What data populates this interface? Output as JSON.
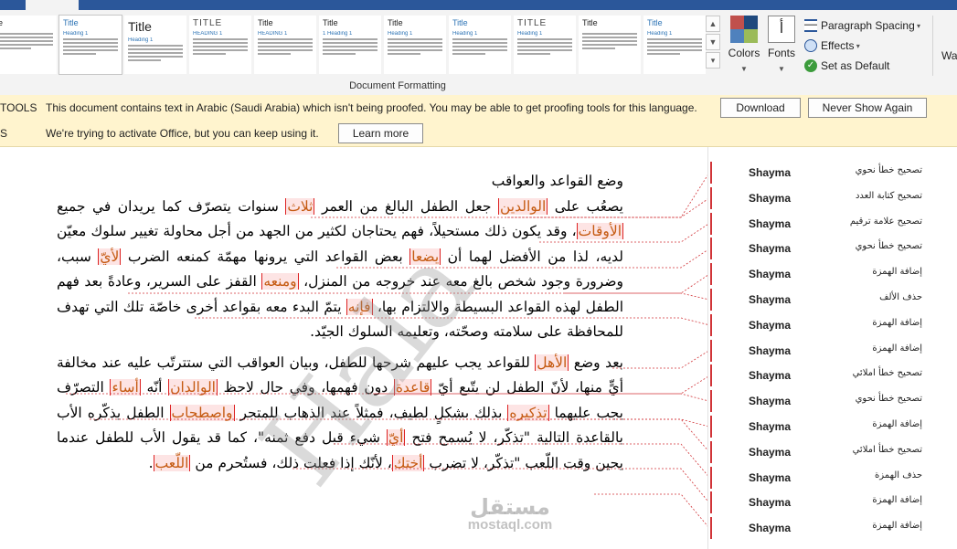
{
  "ribbon": {
    "style_set": [
      {
        "title": "e",
        "heading": "",
        "variant": "dark"
      },
      {
        "title": "Title",
        "heading": "Heading 1",
        "variant": "plain"
      },
      {
        "title": "Title",
        "heading": "Heading 1",
        "variant": "big"
      },
      {
        "title": "TITLE",
        "heading": "HEADING 1",
        "variant": "caps"
      },
      {
        "title": "Title",
        "heading": "HEADING 1",
        "variant": "dark"
      },
      {
        "title": "Title",
        "heading": "1  Heading 1",
        "variant": "dark"
      },
      {
        "title": "Title",
        "heading": "Heading 1",
        "variant": "dark"
      },
      {
        "title": "Title",
        "heading": "Heading 1",
        "variant": "plain"
      },
      {
        "title": "TITLE",
        "heading": "Heading 1",
        "variant": "caps"
      },
      {
        "title": "Title",
        "heading": "",
        "variant": "dark"
      },
      {
        "title": "Title",
        "heading": "Heading 1",
        "variant": "plain"
      }
    ],
    "group_label": "Document Formatting",
    "colors_label": "Colors",
    "fonts_label": "Fonts",
    "fonts_glyph": "أ",
    "paragraph_spacing_label": "Paragraph Spacing",
    "effects_label": "Effects",
    "set_default_label": "Set as Default",
    "cut_off_label": "Wa",
    "colors": {
      "accent": "#2b579a",
      "swatch_a": "#c0504d",
      "swatch_b": "#1f497d",
      "swatch_c": "#4f81bd",
      "swatch_d": "#9bbb59"
    }
  },
  "proofing_bar": {
    "tag": "TOOLS",
    "message": "This document contains text in Arabic (Saudi Arabia) which isn't being proofed. You may be able to get proofing tools for this language.",
    "download_label": "Download",
    "never_show_label": "Never Show Again"
  },
  "activation_bar": {
    "tag": "S",
    "message": "We're trying to activate Office, but you can keep using it.",
    "learn_more_label": "Learn more"
  },
  "document": {
    "title": "وضع القواعد والعواقب",
    "p1": {
      "s1": "يصعُب على ",
      "r1": "الوالدين",
      "s2": " جعل الطفل البالغ من العمر ",
      "r2": "ثلاث",
      "s3": " سنوات يتصرّف كما يريدان في جميع ",
      "r3": "الأوقات",
      "s4": "، وقد يكون ذلك مستحيلاً، فهم يحتاجان لكثير من الجهد من أجل محاولة تغيير سلوك معيّن لديه، لذا من الأفضل لهما أن ",
      "r4": "يضعا",
      "s5": " بعض القواعد التي يرونها مهمّة كمنعه الضرب ",
      "r5": "لأيّ",
      "s6": " سبب، وضرورة وجود شخص بالغ معه عند خروجه من المنزل، ",
      "r6": "ومنعه",
      "s7": " القفز على السرير، وعادةً بعد فهم الطفل لهذه القواعد البسيطة والالتزام بها، ",
      "r7": "فإنه",
      "s8": " يتمّ البدء معه بقواعد أخرى خاصّة تلك التي تهدف للمحافظة على سلامته وصحّته، وتعليمه السلوك الجيّد."
    },
    "p2": {
      "s1": "بعد وضع ",
      "r1": "الأهل",
      "s2": " للقواعد يجب عليهم شرحها للطفل، وبيان العواقب التي ستترتّب عليه عند مخالفة أيٍّ منها، لأنّ الطفل لن يتّبع أيّ ",
      "r2": "قاعدة",
      "s3": " دون فهمها، وفي حال لاحظ ",
      "r3": "الوالدان",
      "s4": " أنّه ",
      "r4": "أساء",
      "s5": " التصرّف يجب عليهما ",
      "r5": "تذكيره",
      "s6": " بذلك بشكلٍ لطيف، فمثلاً عند الذهاب للمتجر ",
      "r6": "واصطحاب",
      "s7": " الطفل يذكّره الأب بالقاعدة التالية \"تذكّر، لا يُسمح فتح ",
      "r7": "أيّ",
      "s8": " شيء قبل دفع ثمنه\"، كما قد يقول الأب للطفل عندما يحين وقت اللّعب \"تذكّر، لا تضرب ",
      "r8": "أختك",
      "s9": "، لأنّك إذا فعلت ذلك، فستُحرم من ",
      "r9": "اللّعب",
      "s10": "."
    }
  },
  "comments": [
    {
      "author": "Shayma",
      "note": "تصحيح خطأ نحوي"
    },
    {
      "author": "Shayma",
      "note": "تصحيح كتابة العدد"
    },
    {
      "author": "Shayma",
      "note": "تصحيح علامة ترقيم"
    },
    {
      "author": "Shayma",
      "note": "تصحيح خطأ نحوي"
    },
    {
      "author": "Shayma",
      "note": "إضافة الهمزة"
    },
    {
      "author": "Shayma",
      "note": "حذف الألف"
    },
    {
      "author": "Shayma",
      "note": "إضافة الهمزة"
    },
    {
      "author": "Shayma",
      "note": "إضافة الهمزة"
    },
    {
      "author": "Shayma",
      "note": "تصحيح خطأ املائي"
    },
    {
      "author": "Shayma",
      "note": "تصحيح خطأ نحوي"
    },
    {
      "author": "Shayma",
      "note": "إضافة الهمزة"
    },
    {
      "author": "Shayma",
      "note": "تصحيح خطأ املائي"
    },
    {
      "author": "Shayma",
      "note": "حذف الهمزة"
    },
    {
      "author": "Shayma",
      "note": "إضافة الهمزة"
    },
    {
      "author": "Shayma",
      "note": "إضافة الهمزة"
    }
  ],
  "watermark": {
    "script_text": "Hala",
    "logo_arabic": "مستقل",
    "logo_url": "mostaql.com"
  }
}
